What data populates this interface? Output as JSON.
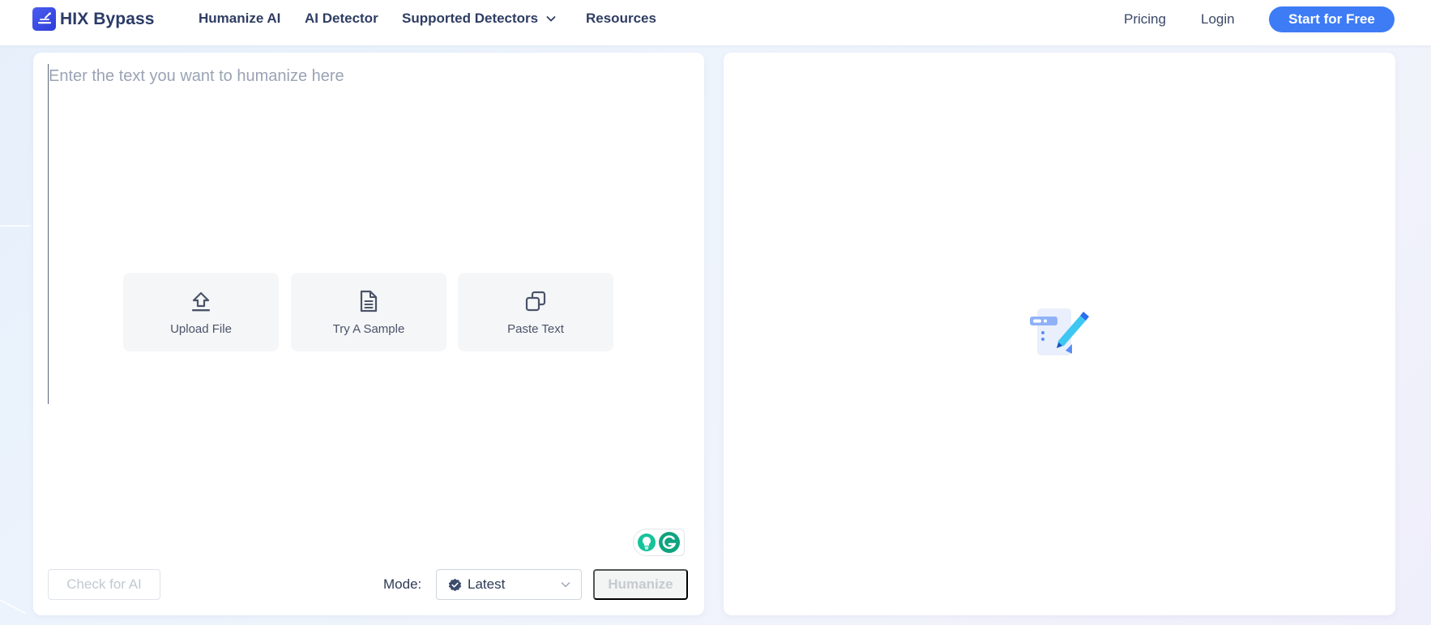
{
  "header": {
    "brand": "HIX Bypass",
    "nav": {
      "humanize_ai": "Humanize AI",
      "ai_detector": "AI Detector",
      "supported_detectors": "Supported Detectors",
      "resources": "Resources"
    },
    "pricing": "Pricing",
    "login": "Login",
    "start_button": "Start for Free"
  },
  "editor": {
    "placeholder": "Enter the text you want to humanize here",
    "actions": {
      "upload": "Upload File",
      "sample": "Try A Sample",
      "paste": "Paste Text"
    },
    "check_button": "Check for AI",
    "mode_label": "Mode:",
    "mode_value": "Latest",
    "humanize_button": "Humanize"
  },
  "colors": {
    "accent": "#3d7cf5",
    "brand": "#2c3fd8",
    "grammarly": "#15c39a"
  }
}
